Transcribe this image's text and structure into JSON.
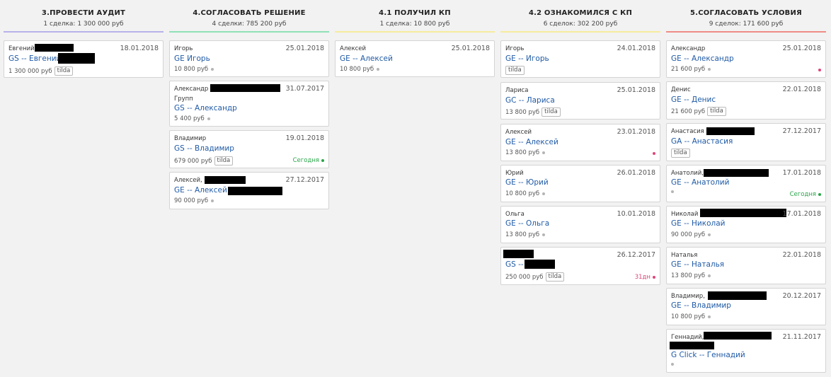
{
  "colors": {
    "stage_3": "#b6b2ea",
    "stage_4": "#8fe0b6",
    "stage_41": "#f6ec9c",
    "stage_42": "#f6ec9c",
    "stage_5": "#f08c86",
    "link": "#1f5aa6",
    "today": "#2aa54a",
    "overdue": "#e0447a"
  },
  "columns": [
    {
      "title": "3.ПРОВЕСТИ АУДИТ",
      "stats": "1 сделка: 1 300 000 руб",
      "cards": [
        {
          "contact": "Евгений",
          "date": "18.01.2018",
          "deal": "GS -- Евгений",
          "amount": "1 300 000 руб",
          "tag": "tilda"
        }
      ]
    },
    {
      "title": "4.СОГЛАСОВАТЬ РЕШЕНИЕ",
      "stats": "4 сделки: 785 200 руб",
      "cards": [
        {
          "contact": "Игорь",
          "date": "25.01.2018",
          "deal": "GE Игорь",
          "amount": "10 800 руб"
        },
        {
          "contact": "Александр",
          "sub": "Групп",
          "date": "31.07.2017",
          "deal": "GS -- Александр",
          "amount": "5 400 руб"
        },
        {
          "contact": "Владимир",
          "date": "19.01.2018",
          "deal": "GS -- Владимир",
          "amount": "679 000 руб",
          "tag": "tilda",
          "status": "Сегодня"
        },
        {
          "contact": "Алексей,",
          "date": "27.12.2017",
          "deal": "GE -- Алексей (",
          "amount": "90 000 руб"
        }
      ]
    },
    {
      "title": "4.1 ПОЛУЧИЛ КП",
      "stats": "1 сделка: 10 800 руб",
      "cards": [
        {
          "contact": "Алексей",
          "date": "25.01.2018",
          "deal": "GE -- Алексей",
          "amount": "10 800 руб"
        }
      ]
    },
    {
      "title": "4.2 ОЗНАКОМИЛСЯ С КП",
      "stats": "6 сделок: 302 200 руб",
      "cards": [
        {
          "contact": "Игорь",
          "date": "24.01.2018",
          "deal": "GE -- Игорь",
          "tag": "tilda"
        },
        {
          "contact": "Лариса",
          "date": "25.01.2018",
          "deal": "GC -- Лариса",
          "amount": "13 800 руб",
          "tag": "tilda"
        },
        {
          "contact": "Алексей",
          "date": "23.01.2018",
          "deal": "GE -- Алексей",
          "amount": "13 800 руб"
        },
        {
          "contact": "Юрий",
          "date": "26.01.2018",
          "deal": "GE -- Юрий",
          "amount": "10 800 руб"
        },
        {
          "contact": "Ольга",
          "date": "10.01.2018",
          "deal": "GE -- Ольга",
          "amount": "13 800 руб"
        },
        {
          "contact": "",
          "date": "26.12.2017",
          "deal": "GS --",
          "amount": "250 000 руб",
          "tag": "tilda",
          "status": "31дн"
        }
      ]
    },
    {
      "title": "5.СОГЛАСОВАТЬ УСЛОВИЯ",
      "stats": "9 сделок: 171 600 руб",
      "cards": [
        {
          "contact": "Александр",
          "date": "25.01.2018",
          "deal": "GE -- Александр",
          "amount": "21 600 руб"
        },
        {
          "contact": "Денис",
          "date": "22.01.2018",
          "deal": "GE -- Денис",
          "amount": "21 600 руб",
          "tag": "tilda"
        },
        {
          "contact": "Анастасия",
          "date": "27.12.2017",
          "deal": "GA -- Анастасия",
          "tag": "tilda"
        },
        {
          "contact": "Анатолий,",
          "date": "17.01.2018",
          "deal": "GE -- Анатолий",
          "status": "Сегодня"
        },
        {
          "contact": "Николай",
          "date": "17.01.2018",
          "deal": "GE -- Николай",
          "amount": "90 000 руб"
        },
        {
          "contact": "Наталья",
          "date": "22.01.2018",
          "deal": "GE -- Наталья",
          "amount": "13 800 руб"
        },
        {
          "contact": "Владимир,",
          "date": "20.12.2017",
          "deal": "GE -- Владимир",
          "amount": "10 800 руб"
        },
        {
          "contact": "Геннадий,",
          "date": "21.11.2017",
          "deal": "G Click -- Геннадий"
        }
      ]
    }
  ]
}
